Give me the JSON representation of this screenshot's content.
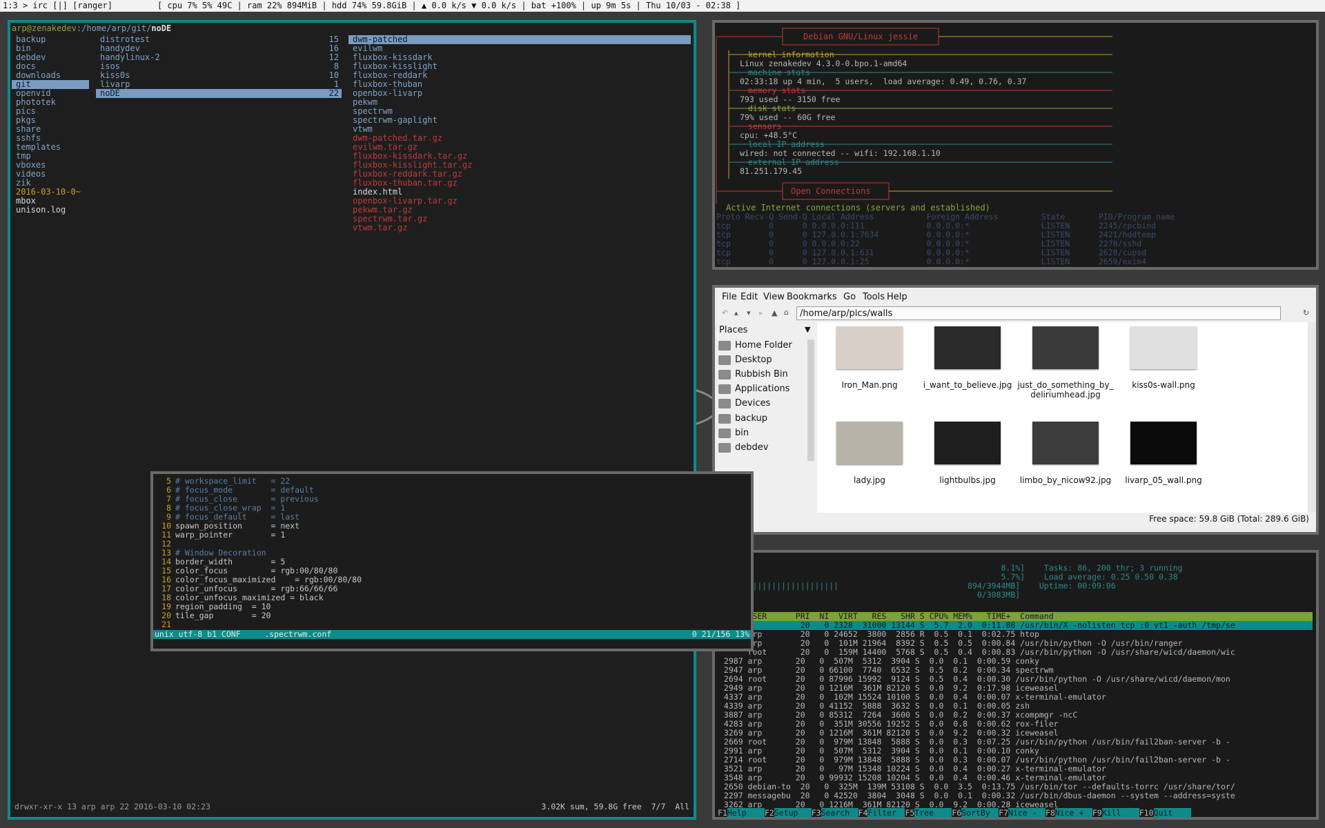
{
  "topbar": {
    "text": "1:3 > irc [|] [ranger]         [ cpu 7% 5% 49C | ram 22% 894MiB | hdd 74% 59.8GiB | ▲ 0.0 k/s ▼ 0.0 k/s | bat +100% | up 9m 5s | Thu 10/03 - 02:38 ]"
  },
  "ranger": {
    "prompt_user": "arp@zenakedev",
    "prompt_path": ":/home/arp/git/",
    "prompt_sel": "noDE",
    "col1": [
      "backup",
      "bin",
      "debdev",
      "docs",
      "downloads",
      "git",
      "openvid",
      "phototek",
      "pics",
      "pkgs",
      "share",
      "sshfs",
      "templates",
      "tmp",
      "vboxes",
      "videos",
      "zik",
      "2016-03-10-0~",
      "mbox",
      "unison.log"
    ],
    "col2": [
      {
        "name": "distrotest",
        "count": "15"
      },
      {
        "name": "handydev",
        "count": "16"
      },
      {
        "name": "handylinux-2",
        "count": "12"
      },
      {
        "name": "isos",
        "count": "8"
      },
      {
        "name": "kiss0s",
        "count": "10"
      },
      {
        "name": "livarp",
        "count": "1"
      },
      {
        "name": "noDE",
        "count": "22"
      }
    ],
    "col3": [
      "dwm-patched",
      "evilwm",
      "fluxbox-kissdark",
      "fluxbox-kisslight",
      "fluxbox-reddark",
      "fluxbox-thuban",
      "openbox-livarp",
      "pekwm",
      "spectrwm",
      "spectrwm-gaplight",
      "vtwm",
      "dwm-patched.tar.gz",
      "evilwm.tar.gz",
      "fluxbox-kissdark.tar.gz",
      "fluxbox-kisslight.tar.gz",
      "fluxbox-reddark.tar.gz",
      "fluxbox-thuban.tar.gz",
      "index.html",
      "openbox-livarp.tar.gz",
      "pekwm.tar.gz",
      "spectrwm.tar.gz",
      "vtwm.tar.gz"
    ],
    "status_left": "drwxr-xr-x 13 arp arp 22 2016-03-10 02:23",
    "status_right": "3.02K sum, 59.8G free  7/7  All"
  },
  "conky": {
    "title": "Debian GNU/Linux jessie",
    "kernel_h": "kernel information",
    "kernel": "Linux zenakedev 4.3.0-0.bpo.1-amd64",
    "machine_h": "machine stats",
    "machine": "02:33:18 up 4 min,  5 users,  load average: 0.49, 0.76, 0.37",
    "memory_h": "memory stats",
    "memory": "793 used -- 3150 free",
    "disk_h": "disk stats",
    "disk": "79% used -- 60G free",
    "sensors_h": "sensors",
    "sensors": "cpu: +48.5°C",
    "localip_h": "local IP address",
    "localip": "wired: not connected -- wifi: 192.168.1.10",
    "extip_h": "external IP address",
    "extip": "81.251.179.45",
    "conn_title": "Open Connections",
    "active": "Active Internet connections (servers and established)",
    "header": "Proto Recv-Q Send-Q Local Address           Foreign Address         State       PID/Program name",
    "rows": [
      "tcp        0      0 0.0.0.0:111             0.0.0.0:*               LISTEN      2245/rpcbind",
      "tcp        0      0 127.0.0.1:7634          0.0.0.0:*               LISTEN      2421/hddtemp",
      "tcp        0      0 0.0.0.0:22              0.0.0.0:*               LISTEN      2278/sshd",
      "tcp        0      0 127.0.0.1:631           0.0.0.0:*               LISTEN      2628/cupsd",
      "tcp        0      0 127.0.0.1:25            0.0.0.0:*               LISTEN      2659/exim4"
    ]
  },
  "thunar": {
    "menu": [
      "File",
      "Edit",
      "View",
      "Bookmarks",
      "Go",
      "Tools",
      "Help"
    ],
    "path": "/home/arp/pics/walls",
    "places_label": "Places",
    "places": [
      "Home Folder",
      "Desktop",
      "Rubbish Bin",
      "Applications",
      "Devices",
      "backup",
      "bin",
      "debdev"
    ],
    "files": [
      {
        "name": "Iron_Man.png",
        "color": "#d8cfc8"
      },
      {
        "name": "i_want_to_believe.jpg",
        "color": "#2a2a2a"
      },
      {
        "name": "just_do_something_by_\ndeliriumhead.jpg",
        "color": "#3a3a3a"
      },
      {
        "name": "kiss0s-wall.png",
        "color": "#e0e0e0"
      },
      {
        "name": "lady.jpg",
        "color": "#b8b2a8"
      },
      {
        "name": "lightbulbs.jpg",
        "color": "#1e1e1e"
      },
      {
        "name": "limbo_by_nicow92.jpg",
        "color": "#3c3c3c"
      },
      {
        "name": "livarp_05_wall.png",
        "color": "#0a0a0a"
      }
    ],
    "status": "Free space: 59.8 GiB (Total: 289.6 GiB)"
  },
  "htop": {
    "meters": [
      "                                                           8.1%]    Tasks: 86, 200 thr; 3 running",
      "                                                           5.7%]    Load average: 0.25 0.50 0.38",
      " ||||||||||||||||||||||||                           894/3944MB]    Uptime: 00:09:06",
      "                                                      0/3083MB]"
    ],
    "header": "  PID USER      PRI  NI  VIRT   RES   SHR S CPU% MEM%   TIME+  Command",
    "rows": [
      "                 20   0 2328  31000 13144 S  5.7  2.0  0:11.88 /usr/bin/X -nolisten tcp :0 vt1 -auth /tmp/se",
      "      arp        20   0 24652  3800  2856 R  0.5  0.1  0:02.75 htop",
      "      arp        20   0  101M 21964  8392 S  0.5  0.5  0:00.84 /usr/bin/python -O /usr/bin/ranger",
      "      root       20   0  159M 14400  5768 S  0.5  0.4  0:00.83 /usr/bin/python -O /usr/share/wicd/daemon/wic",
      " 2987 arp       20   0  507M  5312  3904 S  0.0  0.1  0:00.59 conky",
      " 2947 arp       20   0 66100  7740  6532 S  0.5  0.2  0:00.34 spectrwm",
      " 2694 root      20   0 87996 15992  9124 S  0.5  0.4  0:00.30 /usr/bin/python -O /usr/share/wicd/daemon/mon",
      " 2949 arp       20   0 1216M  361M 82120 S  0.0  9.2  0:17.98 iceweasel",
      " 4337 arp       20   0  102M 15524 10100 S  0.0  0.4  0:00.07 x-terminal-emulator",
      " 4339 arp       20   0 41152  5888  3632 S  0.0  0.1  0:00.05 zsh",
      " 3887 arp       20   0 85312  7264  3600 S  0.0  0.2  0:00.37 xcompmgr -ncC",
      " 4283 arp       20   0  351M 30556 19252 S  0.0  0.8  0:00.62 rox-filer",
      " 3269 arp       20   0 1216M  361M 82120 S  0.0  9.2  0:00.32 iceweasel",
      " 2669 root      20   0  979M 13848  5888 S  0.0  0.3  0:07.25 /usr/bin/python /usr/bin/fail2ban-server -b -",
      " 2991 arp       20   0  507M  5312  3904 S  0.0  0.1  0:00.10 conky",
      " 2714 root      20   0  979M 13848  5888 S  0.0  0.3  0:00.07 /usr/bin/python /usr/bin/fail2ban-server -b -",
      " 3521 arp       20   0   97M 15348 10224 S  0.0  0.4  0:00.27 x-terminal-emulator",
      " 3548 arp       20   0 99932 15208 10204 S  0.0  0.4  0:00.46 x-terminal-emulator",
      " 2650 debian-to  20   0  325M  139M 53108 S  0.0  3.5  0:13.75 /usr/bin/tor --defaults-torrc /usr/share/tor/",
      " 2297 messagebu  20   0 42520  3804  3048 S  0.0  0.1  0:00.32 /usr/bin/dbus-daemon --system --address=syste",
      " 3262 arp       20   0 1216M  361M 82120 S  0.0  9.2  0:00.28 iceweasel"
    ],
    "fkeys": [
      {
        "k": "F1",
        "l": "Help"
      },
      {
        "k": "F2",
        "l": "Setup"
      },
      {
        "k": "F3",
        "l": "Search"
      },
      {
        "k": "F4",
        "l": "Filter"
      },
      {
        "k": "F5",
        "l": "Tree"
      },
      {
        "k": "F6",
        "l": "SortBy"
      },
      {
        "k": "F7",
        "l": "Nice -"
      },
      {
        "k": "F8",
        "l": "Nice +"
      },
      {
        "k": "F9",
        "l": "Kill"
      },
      {
        "k": "F10",
        "l": "Quit"
      }
    ]
  },
  "vim": {
    "lines": [
      {
        "n": "5",
        "t": "# workspace_limit   = 22",
        "c": true
      },
      {
        "n": "6",
        "t": "# focus_mode        = default",
        "c": true
      },
      {
        "n": "7",
        "t": "# focus_close       = previous",
        "c": true
      },
      {
        "n": "8",
        "t": "# focus_close_wrap  = 1",
        "c": true
      },
      {
        "n": "9",
        "t": "# focus_default     = last",
        "c": true
      },
      {
        "n": "10",
        "t": "spawn_position      = next",
        "c": false
      },
      {
        "n": "11",
        "t": "warp_pointer        = 1",
        "c": false
      },
      {
        "n": "12",
        "t": "",
        "c": false
      },
      {
        "n": "13",
        "t": "# Window Decoration",
        "c": true
      },
      {
        "n": "14",
        "t": "border_width        = 5",
        "c": false
      },
      {
        "n": "15",
        "t": "color_focus         = rgb:00/80/80",
        "c": false
      },
      {
        "n": "16",
        "t": "color_focus_maximized    = rgb:00/80/80",
        "c": false
      },
      {
        "n": "17",
        "t": "color_unfocus       = rgb:66/66/66",
        "c": false
      },
      {
        "n": "18",
        "t": "color_unfocus_maximized = black",
        "c": false
      },
      {
        "n": "19",
        "t": "region_padding  = 10",
        "c": false
      },
      {
        "n": "20",
        "t": "tile_gap        = 20",
        "c": false
      },
      {
        "n": "21",
        "t": "",
        "c": false
      }
    ],
    "status_left": "unix utf-8 b1 CONF     .spectrwm.conf",
    "status_right": "0 21/156 13%"
  }
}
